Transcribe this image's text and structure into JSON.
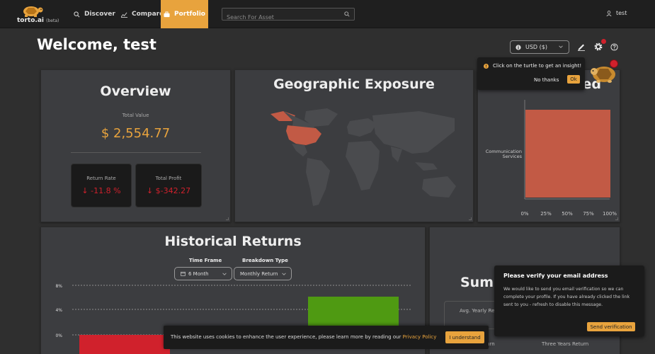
{
  "nav": {
    "logo_text": "torto.ai",
    "logo_beta": "(beta)",
    "discover": "Discover",
    "compare": "Compare",
    "portfolio": "Portfolio",
    "search_placeholder": "Search For Asset",
    "username": "test"
  },
  "page": {
    "welcome": "Welcome, test",
    "currency": "USD ($)"
  },
  "insight": {
    "message": "Click on the turtle to get an insight!",
    "no_thanks": "No thanks",
    "ok": "Ok"
  },
  "overview": {
    "title": "Overview",
    "total_value_label": "Total Value",
    "total_value": "$ 2,554.77",
    "return_rate_label": "Return Rate",
    "return_rate": "-11.8 %",
    "total_profit_label": "Total Profit",
    "total_profit": "$-342.27"
  },
  "geo": {
    "title": "Geographic Exposure"
  },
  "sector": {
    "title_fragment": "ed"
  },
  "historical": {
    "title": "Historical Returns",
    "timeframe_label": "Time Frame",
    "timeframe_value": "6 Month",
    "breakdown_label": "Breakdown Type",
    "breakdown_value": "Monthly Return"
  },
  "summary": {
    "title_fragment": "Summ",
    "avg_label": "Avg. Yearly Re",
    "foot1": "eturn",
    "foot2": "Three Years Return"
  },
  "verify": {
    "title": "Please verify your email address",
    "body": "We would like to send you email verification so we can complete your profile. If you have already clicked the link sent to you - refresh to disable this message.",
    "button": "Send verification"
  },
  "cookie": {
    "text": "This website uses cookies to enhance the user experience, please learn more by reading our ",
    "link": "Privacy Policy",
    "button": "I understand"
  },
  "colors": {
    "accent": "#e8a33d",
    "negative": "#d0212c",
    "positive": "#4f9a12",
    "map_highlight": "#c25a45",
    "sector_bar": "#c25a45"
  },
  "chart_data": [
    {
      "type": "bar",
      "orientation": "horizontal",
      "categories": [
        "Communication Services"
      ],
      "values": [
        100
      ],
      "xlim": [
        0,
        100
      ],
      "xticks": [
        "0%",
        "25%",
        "50%",
        "75%",
        "100%"
      ]
    },
    {
      "type": "bar",
      "yticks": [
        "8%",
        "4%",
        "0%"
      ],
      "values_visible": [
        -5,
        6
      ],
      "series_colors": [
        "#d0212c",
        "#4f9a12"
      ]
    }
  ]
}
